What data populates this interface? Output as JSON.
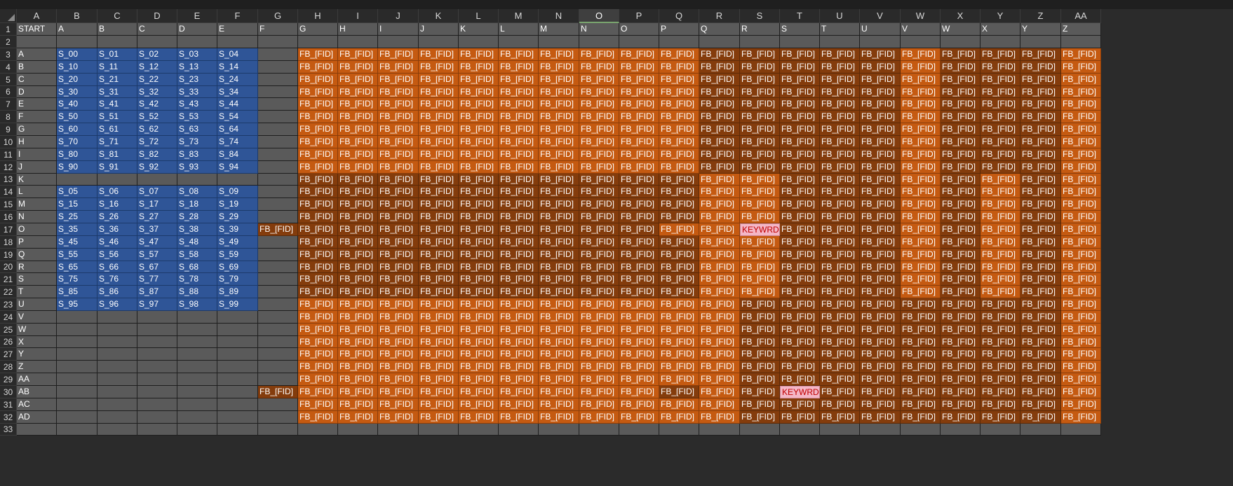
{
  "sheet": {
    "selected_column": "O",
    "colors": {
      "header_bg": "#2a2a2a",
      "gray_cell": "#5a5a5a",
      "blue_cell": "#2f5597",
      "orange_light": "#c55a11",
      "orange_dark": "#843c0c",
      "keyword_bg": "#f4b6c6",
      "keyword_text": "#c00000"
    },
    "columns": [
      "A",
      "B",
      "C",
      "D",
      "E",
      "F",
      "G",
      "H",
      "I",
      "J",
      "K",
      "L",
      "M",
      "N",
      "O",
      "P",
      "Q",
      "R",
      "S",
      "T",
      "U",
      "V",
      "W",
      "X",
      "Y",
      "Z",
      "AA"
    ],
    "rows": [
      "1",
      "2",
      "3",
      "4",
      "5",
      "6",
      "7",
      "8",
      "9",
      "10",
      "11",
      "12",
      "13",
      "14",
      "15",
      "16",
      "17",
      "18",
      "19",
      "20",
      "21",
      "22",
      "23",
      "24",
      "25",
      "26",
      "27",
      "28",
      "29",
      "30",
      "31",
      "32",
      "33"
    ],
    "header_row": [
      "START",
      "A",
      "B",
      "C",
      "D",
      "E",
      "F",
      "G",
      "H",
      "I",
      "J",
      "K",
      "L",
      "M",
      "N",
      "O",
      "P",
      "Q",
      "R",
      "S",
      "T",
      "U",
      "V",
      "W",
      "X",
      "Y",
      "Z"
    ],
    "row_labels": [
      "A",
      "B",
      "C",
      "D",
      "E",
      "F",
      "G",
      "H",
      "I",
      "J",
      "K",
      "L",
      "M",
      "N",
      "O",
      "P",
      "Q",
      "R",
      "S",
      "T",
      "U",
      "V",
      "W",
      "X",
      "Y",
      "Z",
      "AA",
      "AB",
      "AC",
      "AD"
    ],
    "s_grid": [
      [
        "S_00",
        "S_01",
        "S_02",
        "S_03",
        "S_04"
      ],
      [
        "S_10",
        "S_11",
        "S_12",
        "S_13",
        "S_14"
      ],
      [
        "S_20",
        "S_21",
        "S_22",
        "S_23",
        "S_24"
      ],
      [
        "S_30",
        "S_31",
        "S_32",
        "S_33",
        "S_34"
      ],
      [
        "S_40",
        "S_41",
        "S_42",
        "S_43",
        "S_44"
      ],
      [
        "S_50",
        "S_51",
        "S_52",
        "S_53",
        "S_54"
      ],
      [
        "S_60",
        "S_61",
        "S_62",
        "S_63",
        "S_64"
      ],
      [
        "S_70",
        "S_71",
        "S_72",
        "S_73",
        "S_74"
      ],
      [
        "S_80",
        "S_81",
        "S_82",
        "S_83",
        "S_84"
      ],
      [
        "S_90",
        "S_91",
        "S_92",
        "S_93",
        "S_94"
      ],
      [
        "",
        "",
        "",
        "",
        ""
      ],
      [
        "S_05",
        "S_06",
        "S_07",
        "S_08",
        "S_09"
      ],
      [
        "S_15",
        "S_16",
        "S_17",
        "S_18",
        "S_19"
      ],
      [
        "S_25",
        "S_26",
        "S_27",
        "S_28",
        "S_29"
      ],
      [
        "S_35",
        "S_36",
        "S_37",
        "S_38",
        "S_39"
      ],
      [
        "S_45",
        "S_46",
        "S_47",
        "S_48",
        "S_49"
      ],
      [
        "S_55",
        "S_56",
        "S_57",
        "S_58",
        "S_59"
      ],
      [
        "S_65",
        "S_66",
        "S_67",
        "S_68",
        "S_69"
      ],
      [
        "S_75",
        "S_76",
        "S_77",
        "S_78",
        "S_79"
      ],
      [
        "S_85",
        "S_86",
        "S_87",
        "S_88",
        "S_89"
      ],
      [
        "S_95",
        "S_96",
        "S_97",
        "S_98",
        "S_99"
      ]
    ],
    "g_column_fb_rows": [
      "17",
      "30"
    ],
    "fb_text": "FB_[FID]",
    "keyword_text": "KEYWRD",
    "keywords": [
      {
        "row": "17",
        "column": "S"
      },
      {
        "row": "30",
        "column": "T"
      }
    ]
  }
}
